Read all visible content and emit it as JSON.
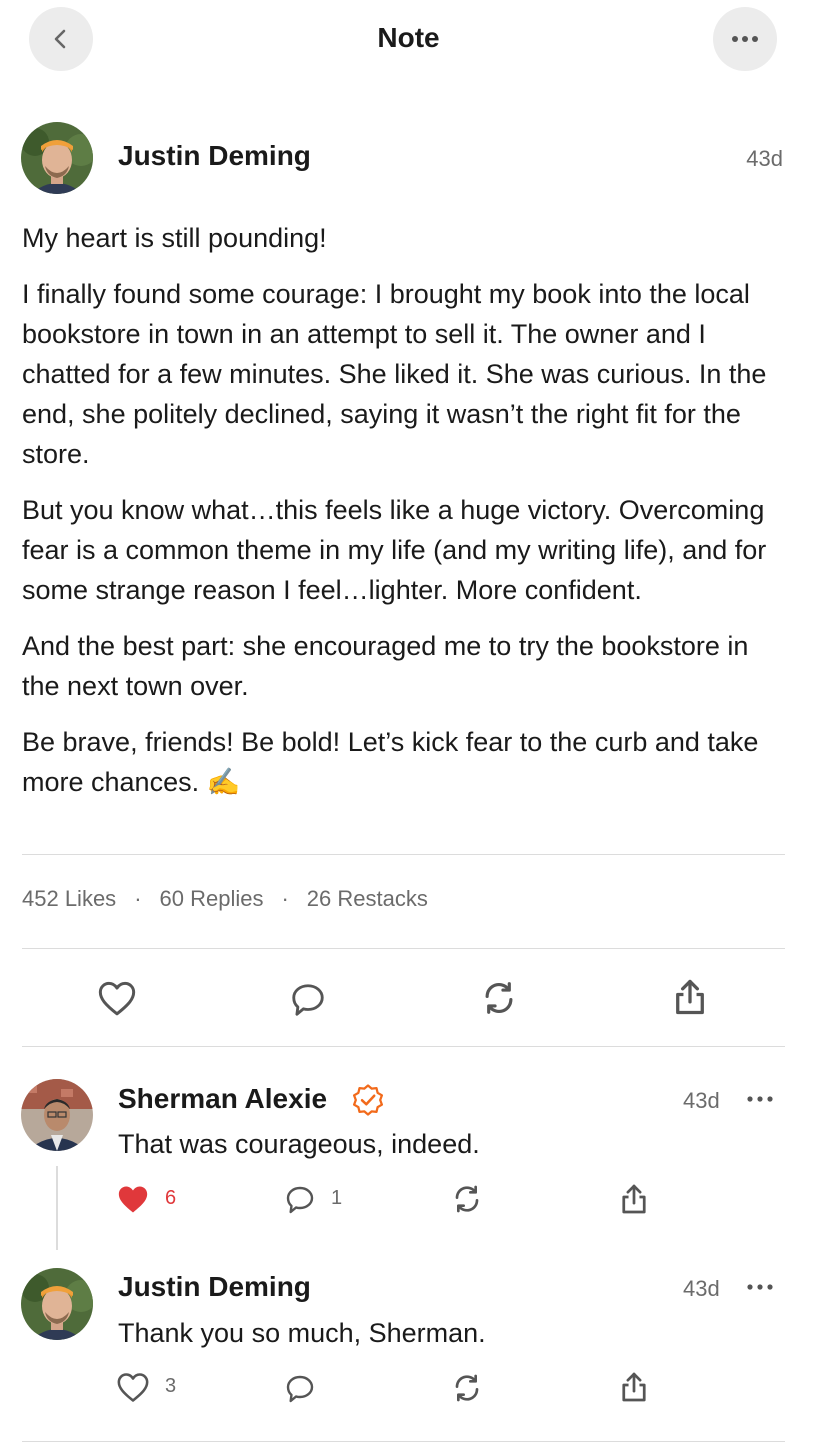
{
  "header": {
    "title": "Note"
  },
  "post": {
    "author": "Justin Deming",
    "time": "43d",
    "paragraphs": [
      "My heart is still pounding!",
      "I finally found some courage: I brought my book into the local bookstore in town in an attempt to sell it. The owner and I chatted for a few minutes. She liked it. She was curious. In the end, she politely declined, saying it wasn’t the right fit for the store.",
      "But you know what…this feels like a huge victory. Overcoming fear is a common theme in my life (and my writing life), and for some strange reason I feel…lighter. More confident.",
      "And the best part: she encouraged me to try the bookstore in the next town over.",
      "Be brave, friends! Be bold! Let’s kick fear to the curb and take more chances. ✍️"
    ]
  },
  "stats": {
    "likes": "452 Likes",
    "replies": "60 Replies",
    "restacks": "26 Restacks",
    "separator": "·"
  },
  "replies": [
    {
      "author": "Sherman Alexie",
      "verified": true,
      "time": "43d",
      "text": "That was courageous, indeed.",
      "likes": "6",
      "liked": true,
      "comments": "1"
    },
    {
      "author": "Justin Deming",
      "verified": false,
      "time": "43d",
      "text": "Thank you so much, Sherman.",
      "likes": "3",
      "liked": false,
      "comments": ""
    }
  ],
  "colors": {
    "accent": "#f26a1b",
    "like_red": "#e0383b",
    "muted": "#6b6b6b"
  },
  "icons": [
    "chevron-left-icon",
    "ellipsis-icon",
    "heart-icon",
    "comment-icon",
    "restack-icon",
    "share-icon",
    "verified-badge-icon"
  ]
}
